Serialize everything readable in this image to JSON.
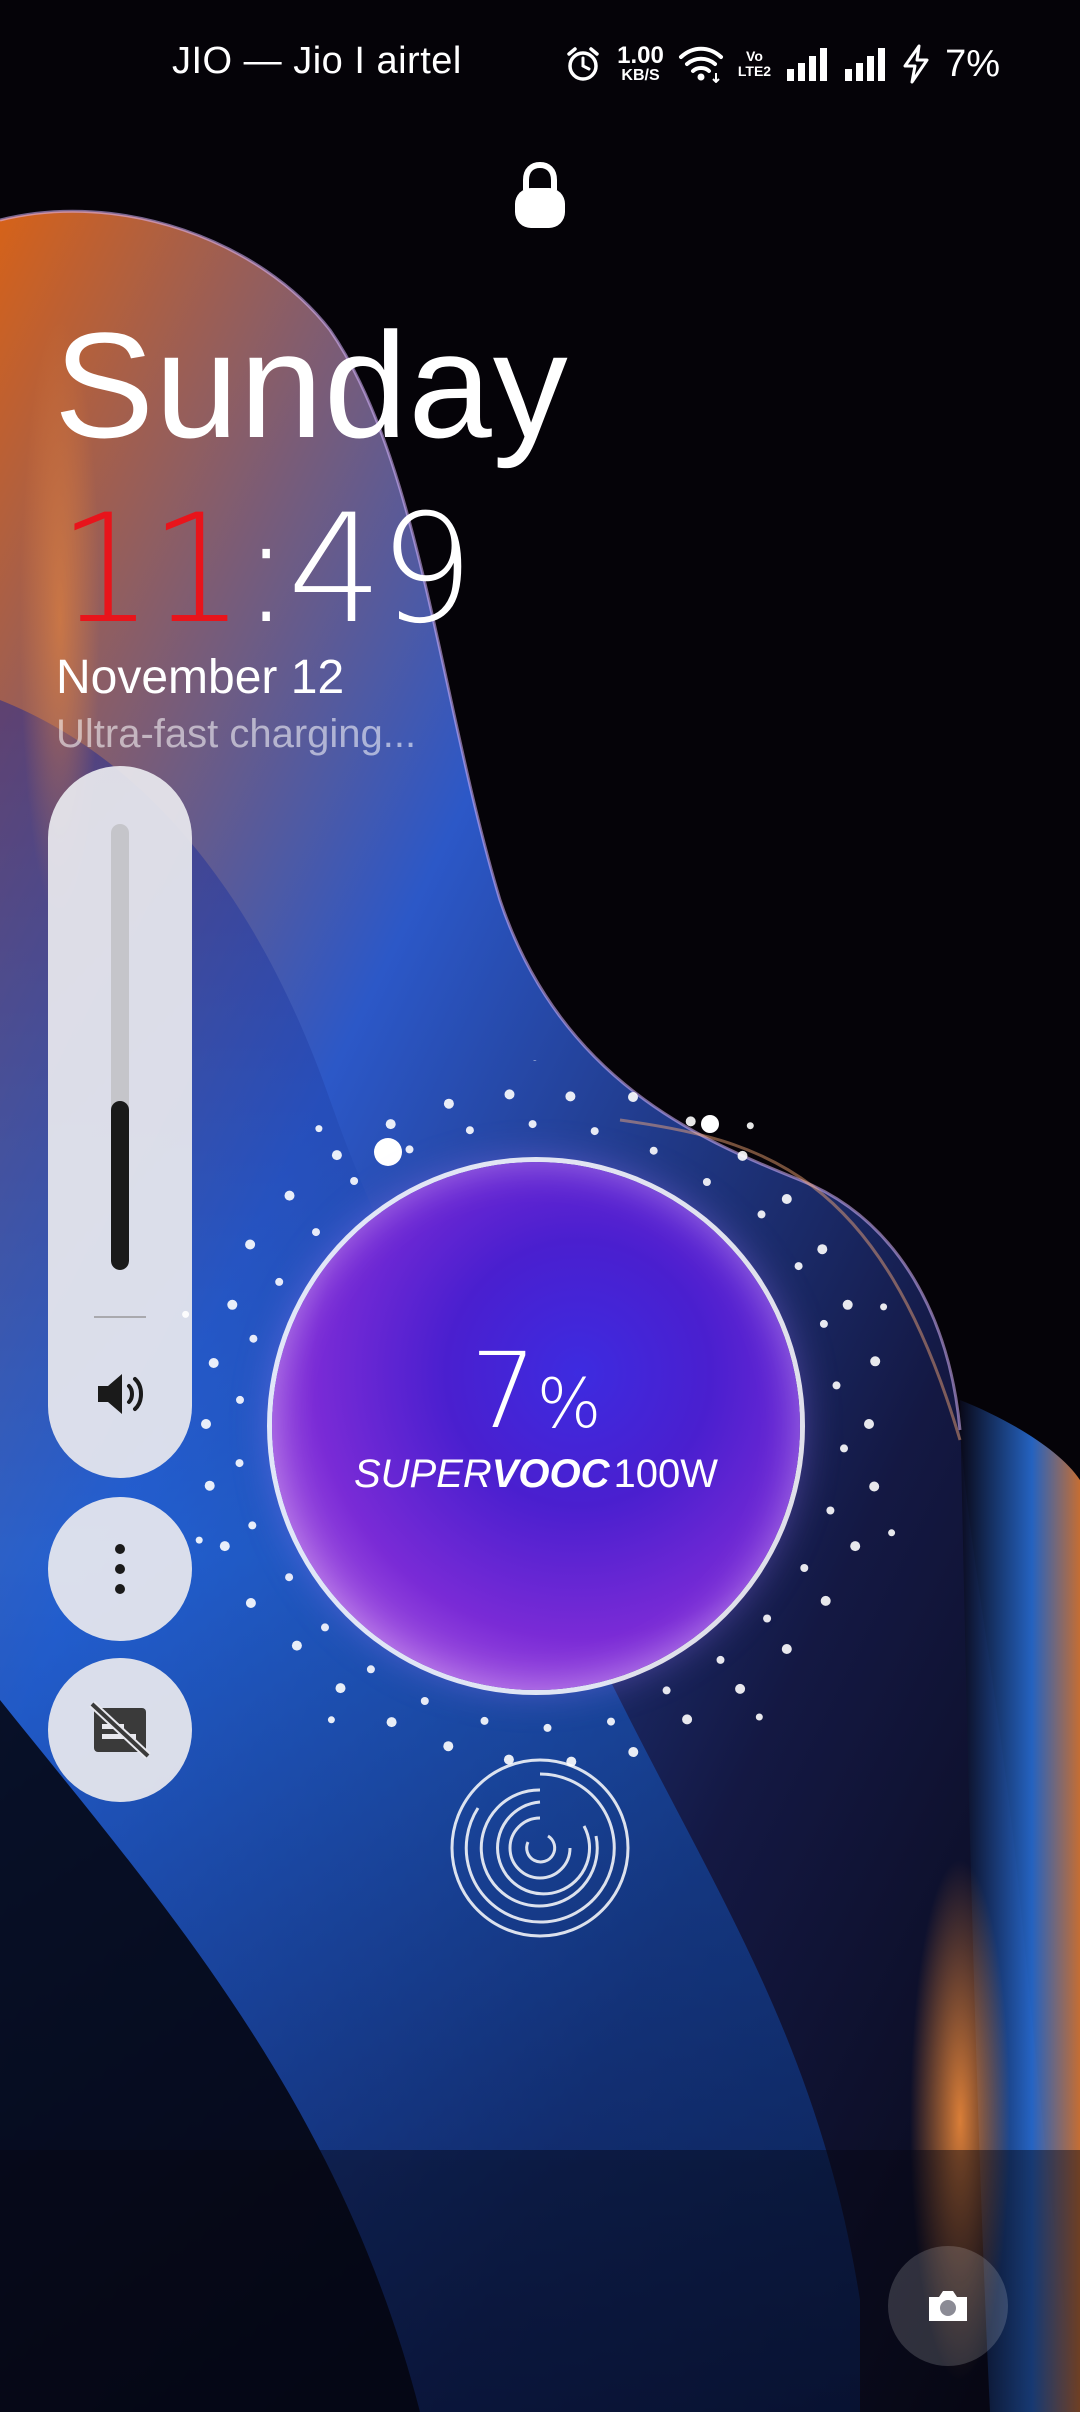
{
  "status_bar": {
    "carrier": "JIO — Jio I airtel",
    "speed_value": "1.00",
    "speed_unit": "KB/S",
    "volte_top": "Vo",
    "volte_bottom": "LTE2",
    "battery_percent": "7%",
    "icons": [
      "alarm-icon",
      "wifi-icon",
      "volte-icon",
      "signal-icon",
      "signal-icon",
      "charging-bolt-icon"
    ]
  },
  "lock": {
    "icon": "lock-icon"
  },
  "clock": {
    "day": "Sunday",
    "hours": "11",
    "separator": ":",
    "minutes": "49",
    "date": "November 12",
    "hour_color": "#e8141b"
  },
  "charging": {
    "status_text": "Ultra-fast charging...",
    "percent_value": "7",
    "percent_sign": "%",
    "brand_part1": "SUPER",
    "brand_part2": "VOOC",
    "brand_tm": "™",
    "brand_power": "100W",
    "battery_level": 0.07
  },
  "volume_panel": {
    "level": 0.38,
    "icons": [
      "speaker-icon",
      "more-options-icon",
      "captions-off-icon"
    ]
  },
  "bottom": {
    "icons": [
      "fingerprint-icon",
      "camera-icon"
    ]
  }
}
